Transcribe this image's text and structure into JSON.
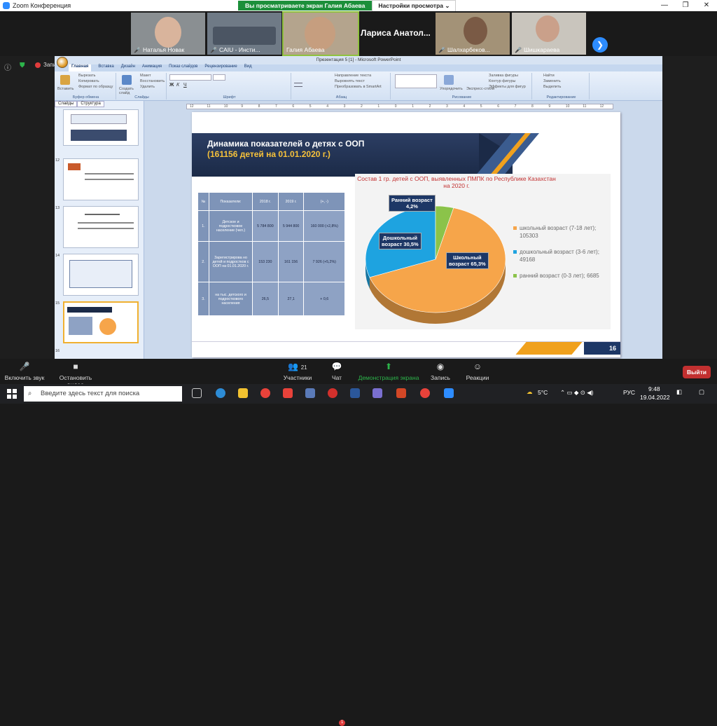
{
  "zoom": {
    "title": "Zoom Конференция",
    "sharing_label": "Вы просматриваете экран Галия Абаева",
    "view_options": "Настройки просмотра",
    "window_controls": [
      "—",
      "❐",
      "✕"
    ]
  },
  "participants": [
    {
      "name": "Наталья Новак"
    },
    {
      "name": "CAIU - Инсти..."
    },
    {
      "name": "Галия Абаева"
    },
    {
      "name": "Лариса  Анатол..."
    },
    {
      "name": "Шалхарбеков..."
    },
    {
      "name": "Шишкараева"
    }
  ],
  "left_edge": {
    "label": "Запи"
  },
  "ppt": {
    "window_title": "Презентация 5 [1] - Microsoft PowerPoint",
    "tabs": [
      "Главная",
      "Вставка",
      "Дизайн",
      "Анимация",
      "Показ слайдов",
      "Рецензирование",
      "Вид"
    ],
    "groups": [
      "Буфер обмена",
      "Слайды",
      "Шрифт",
      "Абзац",
      "Рисование",
      "Редактирование"
    ],
    "clipboard": {
      "paste": "Вставить",
      "cut": "Вырезать",
      "copy": "Копировать",
      "format": "Формат по образцу"
    },
    "slides_grp": {
      "new": "Создать слайд",
      "layout": "Макет",
      "reset": "Восстановить",
      "delete": "Удалить"
    },
    "paragraph": {
      "dir": "Направление текста",
      "align": "Выровнять текст",
      "smartart": "Преобразовать в SmartArt"
    },
    "drawing": {
      "arrange": "Упорядочить",
      "quick": "Экспресс-стили",
      "fill": "Заливка фигуры",
      "outline": "Контур фигуры",
      "effects": "Эффекты для фигур"
    },
    "editing": {
      "find": "Найти",
      "replace": "Заменить",
      "select": "Выделить"
    },
    "panel_tabs": [
      "Слайды",
      "Структура"
    ],
    "thumb_numbers": [
      "12",
      "13",
      "14",
      "15",
      "16"
    ],
    "ruler": [
      "12",
      "11",
      "10",
      "9",
      "8",
      "7",
      "6",
      "5",
      "4",
      "3",
      "2",
      "1",
      "0",
      "1",
      "2",
      "3",
      "4",
      "5",
      "6",
      "7",
      "8",
      "9",
      "10",
      "11",
      "12"
    ]
  },
  "slide": {
    "title_line1": "Динамика показателей  о детях с ООП",
    "title_open": "(",
    "title_highlight": "161156 детей  на 01.01.2020",
    "title_close": "  г.)",
    "table": {
      "headers": [
        "№",
        "Показатели:",
        "2018 г.",
        "2019 г.",
        "(+, -)"
      ],
      "rows": [
        [
          "1.",
          "Детское и подростковое население (чел.)",
          "5 784 800",
          "5 944 800",
          "160 000 (+2,8%)"
        ],
        [
          "2.",
          "Зарегистрирова но детей и подростков с ООП на 01.01.2020  г.",
          "153 230",
          "161 156",
          "7 926 (+5,2%)"
        ],
        [
          "3.",
          "на тыс. детского и подросткового населения",
          "26,5",
          "27,1",
          "+ 0,6"
        ]
      ]
    },
    "page_number": "16"
  },
  "chart_data": {
    "type": "pie",
    "title": "Состав 1 гр. детей с ООП, выявленных ПМПК по Республике Казахстан на 2020 г.",
    "categories": [
      "школьный возраст (7-18 лет)",
      "дошкольный возраст (3-6 лет)",
      "ранний возраст (0-3 лет)"
    ],
    "values": [
      105303,
      49168,
      6685
    ],
    "legend_entries": [
      "школьный возраст (7-18 лет); 105303",
      "дошкольный возраст (3-6 лет); 49168",
      "ранний возраст (0-3 лет); 6685"
    ],
    "data_labels": [
      {
        "line1": "Школьный",
        "line2": "возраст 65,3%"
      },
      {
        "line1": "Дошкольный",
        "line2": "возраст  30,5%"
      },
      {
        "line1": "Ранний возраст",
        "line2": "4,2%"
      }
    ],
    "colors": [
      "#f6a54a",
      "#1ea3e0",
      "#8bc34a"
    ],
    "legend_position": "right"
  },
  "controls": {
    "mute": "Включить звук",
    "video": "Остановить видео",
    "participants": "Участники",
    "participants_count": "21",
    "chat": "Чат",
    "chat_badge": "1",
    "share": "Демонстрация экрана",
    "record": "Запись",
    "reactions": "Реакции",
    "leave": "Выйти"
  },
  "taskbar": {
    "search_placeholder": "Введите здесь текст для поиска",
    "weather": "5°C",
    "lang": "РУС",
    "time": "9:48",
    "date": "19.04.2022"
  }
}
